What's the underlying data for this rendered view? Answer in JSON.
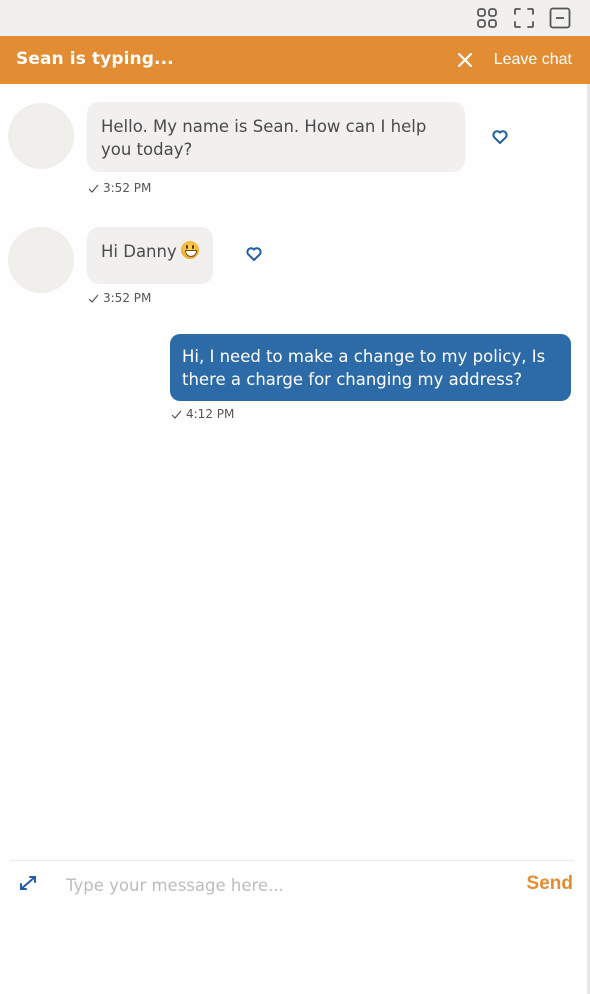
{
  "window_controls": [
    {
      "name": "grid-icon",
      "label": "layout"
    },
    {
      "name": "fullscreen-icon",
      "label": "fullscreen"
    },
    {
      "name": "minimize-icon",
      "label": "minimize"
    }
  ],
  "header": {
    "status": "Sean is typing...",
    "leave_label": "Leave chat",
    "close_icon": "close-icon",
    "background": "#e28c33"
  },
  "messages": [
    {
      "sender": "agent",
      "text": "Hello. My name is Sean. How can I help you today?",
      "time": "3:52 PM",
      "reaction_icon": "heart-icon"
    },
    {
      "sender": "agent",
      "text": "Hi Danny",
      "emoji": "grinning-face",
      "time": "3:52 PM",
      "reaction_icon": "heart-icon"
    },
    {
      "sender": "user",
      "text": "Hi, I need to make a change to my policy, Is there a charge for changing my address?",
      "time": "4:12 PM"
    }
  ],
  "composer": {
    "placeholder": "Type your message here...",
    "value": "",
    "send_label": "Send",
    "expand_icon": "expand-icon"
  },
  "colors": {
    "accent": "#e28c33",
    "user_bubble": "#2d6aa8",
    "agent_bubble": "#f1f0ee",
    "icon_blue": "#1f5fa3"
  }
}
